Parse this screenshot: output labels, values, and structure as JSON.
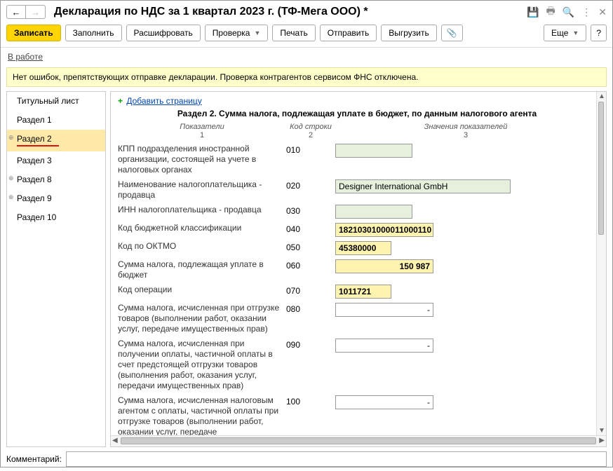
{
  "title": "Декларация по НДС за 1 квартал 2023 г. (ТФ-Мега ООО) *",
  "toolbar": {
    "write": "Записать",
    "fill": "Заполнить",
    "decode": "Расшифровать",
    "check": "Проверка",
    "print": "Печать",
    "send": "Отправить",
    "export": "Выгрузить",
    "more": "Еще",
    "help": "?"
  },
  "status_link": "В работе",
  "notice": "Нет ошибок, препятствующих отправке декларации. Проверка контрагентов сервисом ФНС отключена.",
  "sidebar": {
    "items": [
      {
        "label": "Титульный лист",
        "expandable": false
      },
      {
        "label": "Раздел 1",
        "expandable": false
      },
      {
        "label": "Раздел 2",
        "expandable": true,
        "active": true
      },
      {
        "label": "Раздел 3",
        "expandable": false
      },
      {
        "label": "Раздел 8",
        "expandable": true
      },
      {
        "label": "Раздел 9",
        "expandable": true
      },
      {
        "label": "Раздел 10",
        "expandable": false
      }
    ]
  },
  "add_page": "Добавить страницу",
  "section_title": "Раздел 2. Сумма налога, подлежащая уплате в бюджет, по данным налогового агента",
  "col_heads": {
    "c1": "Показатели",
    "c2": "Код строки",
    "c3": "Значения показателей"
  },
  "col_nums": {
    "c1": "1",
    "c2": "2",
    "c3": "3"
  },
  "rows": [
    {
      "label": "КПП подразделения иностранной организации, состоящей на учете в налоговых органах",
      "code": "010",
      "value": "",
      "cls": "green",
      "w": "w110"
    },
    {
      "label": "Наименование налогоплательщика - продавца",
      "code": "020",
      "value": "Designer International GmbH",
      "cls": "green",
      "w": "w250"
    },
    {
      "label": "ИНН налогоплательщика - продавца",
      "code": "030",
      "value": "",
      "cls": "green",
      "w": "w110"
    },
    {
      "label": "Код бюджетной классификации",
      "code": "040",
      "value": "18210301000011000110",
      "cls": "yellow",
      "w": "w140"
    },
    {
      "label": "Код по ОКТМО",
      "code": "050",
      "value": "45380000",
      "cls": "yellow",
      "w": "w80"
    },
    {
      "label": "Сумма налога, подлежащая уплате в бюджет",
      "code": "060",
      "value": "150 987",
      "cls": "yellow num",
      "w": "w140"
    },
    {
      "label": "Код операции",
      "code": "070",
      "value": "1011721",
      "cls": "yellow",
      "w": "w80"
    },
    {
      "label": "Сумма налога, исчисленная при отгрузке товаров (выполнении работ, оказании услуг, передаче имущественных прав)",
      "code": "080",
      "value": "-",
      "cls": "num",
      "w": "w140"
    },
    {
      "label": "Сумма налога, исчисленная при получении оплаты, частичной оплаты в счет предстоящей отгрузки товаров (выполнения работ, оказания услуг, передачи имущественных прав)",
      "code": "090",
      "value": "-",
      "cls": "num",
      "w": "w140"
    },
    {
      "label": "Сумма налога, исчисленная налоговым агентом с оплаты, частичной оплаты при отгрузке товаров (выполнении работ, оказании услуг, передаче имущественных прав) в счет этой оплаты, частичной оплаты",
      "code": "100",
      "value": "-",
      "cls": "num",
      "w": "w140"
    }
  ],
  "footer": {
    "label": "Комментарий:",
    "value": ""
  }
}
